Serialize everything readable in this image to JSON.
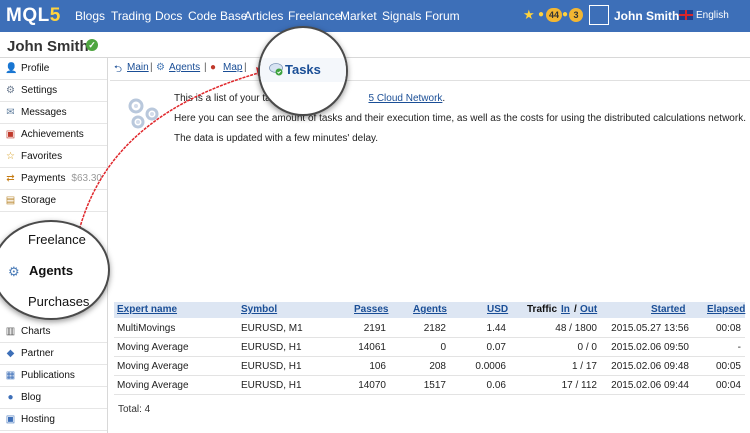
{
  "topnav": {
    "logo_main": "MQL",
    "logo_five": "5",
    "items": [
      "Blogs",
      "Trading",
      "Docs",
      "Code Base",
      "Articles",
      "Freelance",
      "Market",
      "Signals",
      "Forum"
    ],
    "star_icon": "star-icon",
    "badge_1": "44",
    "badge_2": "3",
    "username": "John Smith",
    "language": "English"
  },
  "profile": {
    "name": "John Smith"
  },
  "sidebar": {
    "items": [
      {
        "label": "Profile",
        "icon": "person-icon",
        "sub": ""
      },
      {
        "label": "Settings",
        "icon": "settings-icon",
        "sub": ""
      },
      {
        "label": "Messages",
        "icon": "messages-icon",
        "sub": ""
      },
      {
        "label": "Achievements",
        "icon": "achievements-icon",
        "sub": ""
      },
      {
        "label": "Favorites",
        "icon": "star-icon",
        "sub": ""
      },
      {
        "label": "Payments",
        "icon": "payments-icon",
        "sub": "$63.30"
      },
      {
        "label": "Storage",
        "icon": "storage-icon",
        "sub": ""
      },
      {
        "label": "Charts",
        "icon": "charts-icon",
        "sub": ""
      },
      {
        "label": "Partner",
        "icon": "partner-icon",
        "sub": ""
      },
      {
        "label": "Publications",
        "icon": "publications-icon",
        "sub": ""
      },
      {
        "label": "Blog",
        "icon": "blog-icon",
        "sub": ""
      },
      {
        "label": "Hosting",
        "icon": "hosting-icon",
        "sub": ""
      }
    ]
  },
  "tabs": {
    "main": "Main",
    "agents": "Agents",
    "map": "Map",
    "tasks": "Tasks"
  },
  "intro": {
    "line1_pre": "This is a list of your tasks",
    "line1_link": "5 Cloud Network",
    "line1_post": ".",
    "line2": "Here you can see the amount of tasks and their execution time, as well as the costs for using the distributed calculations network.",
    "line3": "The data is updated with a few minutes' delay."
  },
  "table": {
    "headers": {
      "expert_name": "Expert name",
      "symbol": "Symbol",
      "passes": "Passes",
      "agents": "Agents",
      "usd": "USD",
      "traffic": "Traffic",
      "in": "In",
      "slash": "/",
      "out": "Out",
      "started": "Started",
      "elapsed": "Elapsed"
    },
    "rows": [
      {
        "expert": "MultiMovings",
        "symbol": "EURUSD, M1",
        "passes": "2191",
        "agents": "2182",
        "usd": "1.44",
        "traffic": "48 / 1800",
        "started": "2015.05.27 13:56",
        "elapsed": "00:08"
      },
      {
        "expert": "Moving Average",
        "symbol": "EURUSD, H1",
        "passes": "14061",
        "agents": "0",
        "usd": "0.07",
        "traffic": "0 / 0",
        "started": "2015.02.06 09:50",
        "elapsed": "-"
      },
      {
        "expert": "Moving Average",
        "symbol": "EURUSD, H1",
        "passes": "106",
        "agents": "208",
        "usd": "0.0006",
        "traffic": "1 / 17",
        "started": "2015.02.06 09:48",
        "elapsed": "00:05"
      },
      {
        "expert": "Moving Average",
        "symbol": "EURUSD, H1",
        "passes": "14070",
        "agents": "1517",
        "usd": "0.06",
        "traffic": "17 / 112",
        "started": "2015.02.06 09:44",
        "elapsed": "00:04"
      }
    ],
    "total": "Total: 4"
  },
  "callouts": {
    "tasks_label": "Tasks",
    "side_items": [
      "Freelance",
      "Agents",
      "Purchases"
    ],
    "arrow_color": "#e0262b"
  }
}
